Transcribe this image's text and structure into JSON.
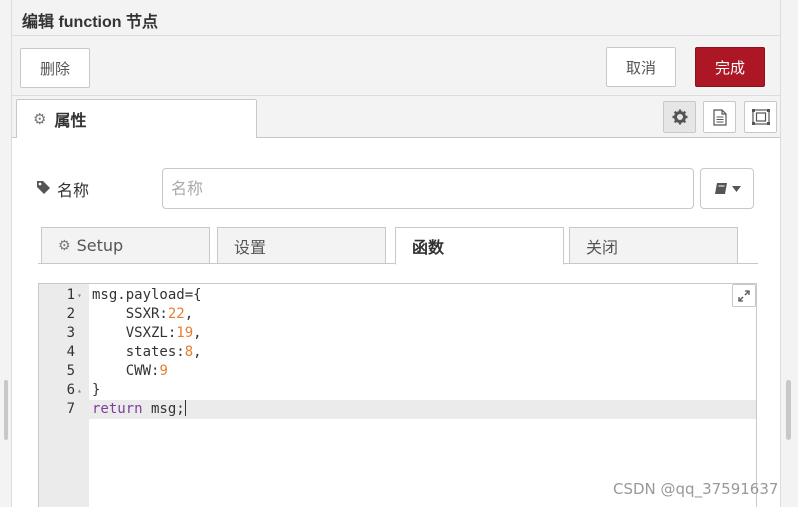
{
  "tray": {
    "title": "编辑 function 节点"
  },
  "toolbar": {
    "delete_label": "删除",
    "cancel_label": "取消",
    "done_label": "完成"
  },
  "tabs": {
    "properties_label": "属性"
  },
  "form": {
    "name_label": "名称",
    "name_placeholder": "名称",
    "name_value": ""
  },
  "subtabs": [
    {
      "label": "Setup",
      "icon": "gear-icon"
    },
    {
      "label": "设置"
    },
    {
      "label": "函数",
      "active": true
    },
    {
      "label": "关闭"
    }
  ],
  "editor": {
    "lines": [
      {
        "num": "1",
        "fold": "▾"
      },
      {
        "num": "2"
      },
      {
        "num": "3"
      },
      {
        "num": "4"
      },
      {
        "num": "5"
      },
      {
        "num": "6",
        "fold": "▴"
      },
      {
        "num": "7",
        "active": true
      }
    ],
    "code": {
      "l1": "msg.payload={",
      "l2_key": "    SSXR:",
      "l2_val": "22",
      "l2_end": ",",
      "l3_key": "    VSXZL:",
      "l3_val": "19",
      "l3_end": ",",
      "l4_key": "    states:",
      "l4_val": "8",
      "l4_end": ",",
      "l5_key": "    CWW:",
      "l5_val": "9",
      "l6": "}",
      "l7_kw": "return",
      "l7_rest": " msg;"
    }
  },
  "watermark": "CSDN @qq_37591637",
  "colors": {
    "done_button": "#ad1625",
    "keyword": "#7a3e9d",
    "number": "#e97d2f"
  }
}
